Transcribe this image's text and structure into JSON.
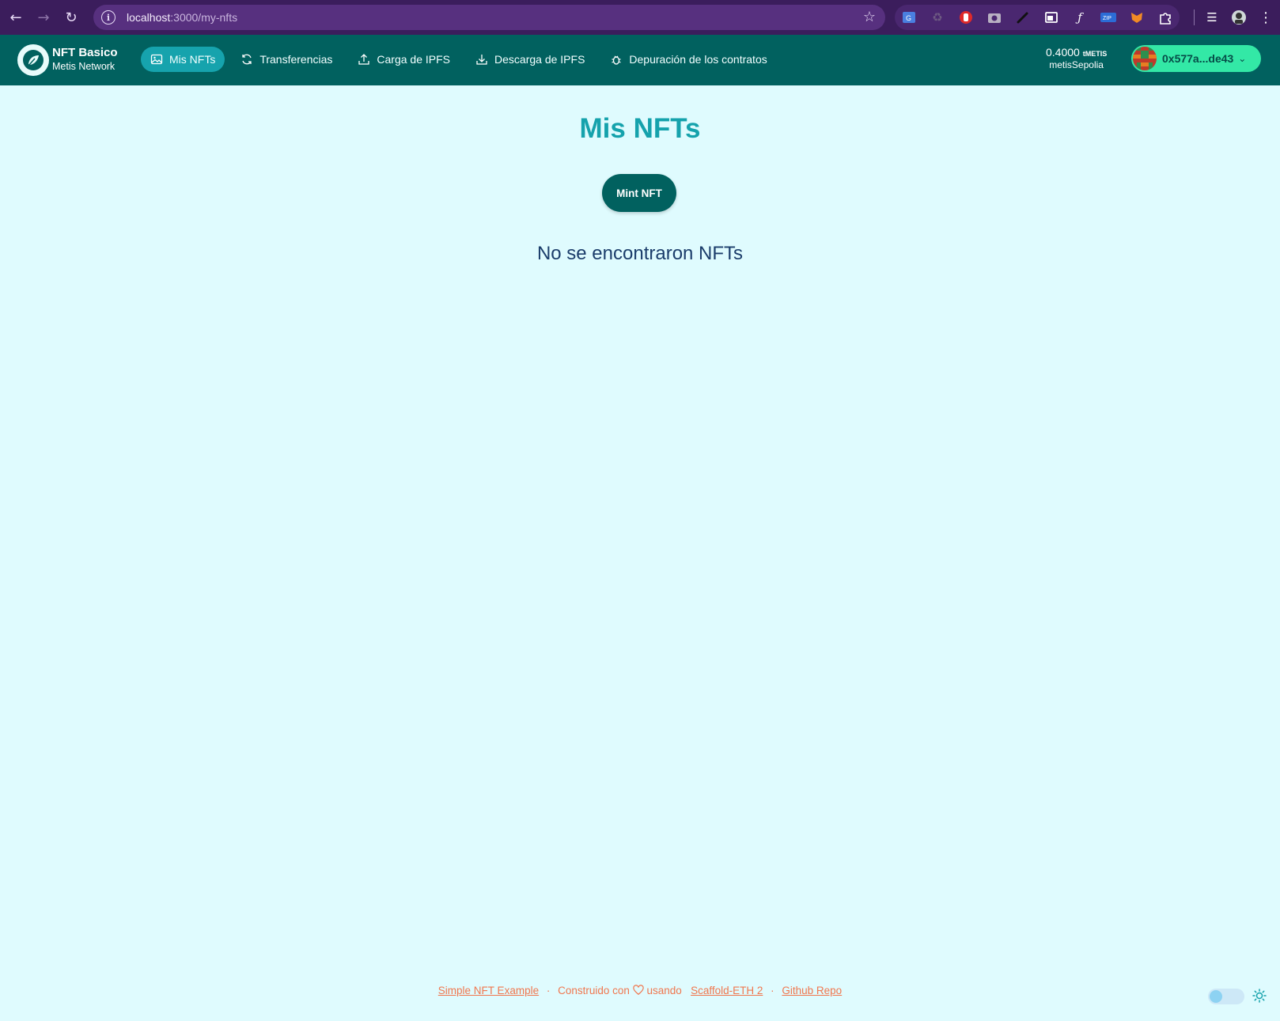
{
  "browser": {
    "url_host": "localhost",
    "url_path": ":3000/my-nfts"
  },
  "app": {
    "brand_title": "NFT Basico",
    "brand_subtitle": "Metis Network",
    "nav": [
      {
        "label": "Mis NFTs",
        "icon": "image-icon",
        "active": true
      },
      {
        "label": "Transferencias",
        "icon": "refresh-icon",
        "active": false
      },
      {
        "label": "Carga de IPFS",
        "icon": "upload-icon",
        "active": false
      },
      {
        "label": "Descarga de IPFS",
        "icon": "download-icon",
        "active": false
      },
      {
        "label": "Depuración de los contratos",
        "icon": "bug-icon",
        "active": false
      }
    ],
    "balance_value": "0.4000",
    "balance_unit": "tMETIS",
    "network": "metisSepolia",
    "account_address": "0x577a...de43"
  },
  "main": {
    "title": "Mis NFTs",
    "mint_button": "Mint NFT",
    "empty_message": "No se encontraron NFTs"
  },
  "footer": {
    "link1": "Simple NFT Example",
    "built_with": "Construido con",
    "using": "usando",
    "link2": "Scaffold-ETH 2",
    "link3": "Github Repo"
  },
  "colors": {
    "header_bg": "#01615f",
    "accent": "#15a2ac",
    "page_bg": "#dffbfe",
    "account_bg": "#33e8a6",
    "footer_link": "#f0774f"
  }
}
